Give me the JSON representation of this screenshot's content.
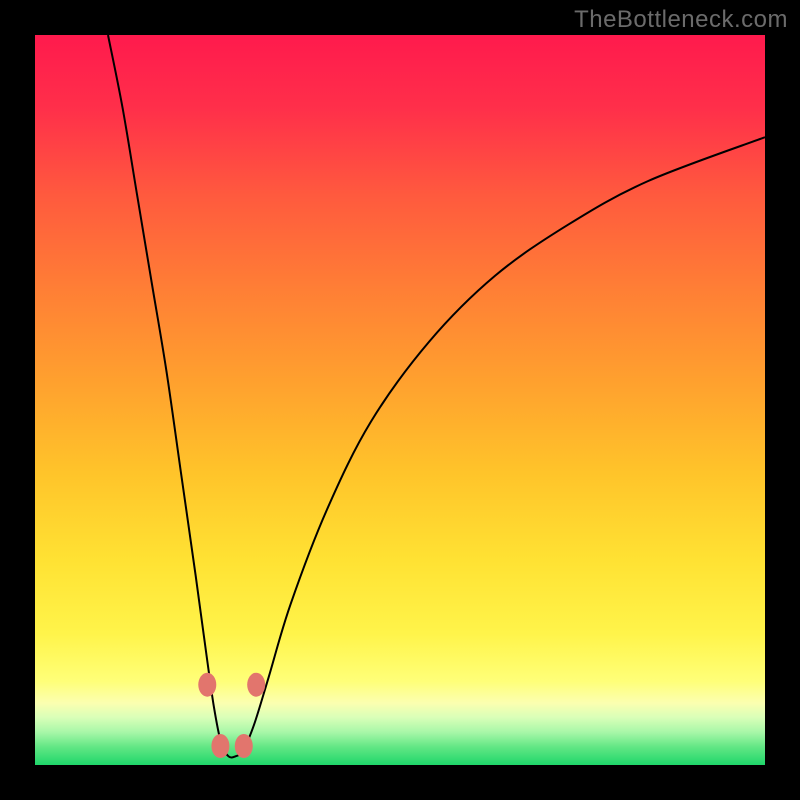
{
  "watermark": "TheBottleneck.com",
  "gradient": {
    "stops": [
      {
        "offset": 0.0,
        "color": "#ff1a4d"
      },
      {
        "offset": 0.1,
        "color": "#ff2f4a"
      },
      {
        "offset": 0.22,
        "color": "#ff5a3e"
      },
      {
        "offset": 0.35,
        "color": "#ff7f35"
      },
      {
        "offset": 0.48,
        "color": "#ffa22e"
      },
      {
        "offset": 0.6,
        "color": "#ffc42a"
      },
      {
        "offset": 0.72,
        "color": "#ffe233"
      },
      {
        "offset": 0.82,
        "color": "#fff44a"
      },
      {
        "offset": 0.885,
        "color": "#ffff78"
      },
      {
        "offset": 0.915,
        "color": "#fbffb0"
      },
      {
        "offset": 0.935,
        "color": "#d9ffb8"
      },
      {
        "offset": 0.955,
        "color": "#a8f7a8"
      },
      {
        "offset": 0.975,
        "color": "#63e785"
      },
      {
        "offset": 1.0,
        "color": "#1fd66a"
      }
    ]
  },
  "curve_style": {
    "stroke": "#000000",
    "stroke_width": 2
  },
  "marker_style": {
    "fill": "#e2756d",
    "rx": 9,
    "ry": 12
  },
  "chart_data": {
    "type": "line",
    "title": "",
    "xlabel": "",
    "ylabel": "",
    "xlim": [
      0,
      100
    ],
    "ylim": [
      0,
      100
    ],
    "notch_x": 27,
    "series": [
      {
        "name": "bottleneck-curve",
        "points": [
          {
            "x": 10.0,
            "y": 100.0
          },
          {
            "x": 12.0,
            "y": 90.0
          },
          {
            "x": 14.0,
            "y": 78.0
          },
          {
            "x": 16.0,
            "y": 66.0
          },
          {
            "x": 18.0,
            "y": 54.0
          },
          {
            "x": 20.0,
            "y": 40.0
          },
          {
            "x": 22.0,
            "y": 26.0
          },
          {
            "x": 23.5,
            "y": 15.0
          },
          {
            "x": 24.5,
            "y": 8.0
          },
          {
            "x": 25.5,
            "y": 3.0
          },
          {
            "x": 26.5,
            "y": 1.2
          },
          {
            "x": 27.5,
            "y": 1.2
          },
          {
            "x": 28.5,
            "y": 2.0
          },
          {
            "x": 30.0,
            "y": 5.5
          },
          {
            "x": 32.0,
            "y": 12.0
          },
          {
            "x": 35.0,
            "y": 22.0
          },
          {
            "x": 40.0,
            "y": 35.0
          },
          {
            "x": 46.0,
            "y": 47.0
          },
          {
            "x": 54.0,
            "y": 58.0
          },
          {
            "x": 63.0,
            "y": 67.0
          },
          {
            "x": 73.0,
            "y": 74.0
          },
          {
            "x": 84.0,
            "y": 80.0
          },
          {
            "x": 100.0,
            "y": 86.0
          }
        ]
      }
    ],
    "markers": [
      {
        "x": 23.6,
        "y": 11.0
      },
      {
        "x": 30.3,
        "y": 11.0
      },
      {
        "x": 25.4,
        "y": 2.6
      },
      {
        "x": 28.6,
        "y": 2.6
      }
    ]
  }
}
